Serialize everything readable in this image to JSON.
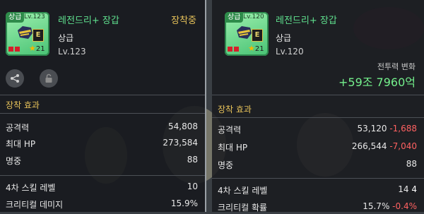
{
  "left": {
    "grade_tag": "상급",
    "level_tag": "Lv.123",
    "item_name": "레전드리+ 장갑",
    "equipped": "장착중",
    "grade": "상급",
    "level": "Lv.123",
    "star_count": "21",
    "e_badge": "E",
    "section_title": "장착 효과",
    "stats": [
      {
        "label": "공격력",
        "value": "54,808"
      },
      {
        "label": "최대 HP",
        "value": "273,584"
      },
      {
        "label": "명중",
        "value": "88"
      },
      {
        "label": "4차 스킬 레벨",
        "value": "10"
      },
      {
        "label": "크리티컬 데미지",
        "value": "15.9%"
      }
    ]
  },
  "right": {
    "grade_tag": "상급",
    "level_tag": "Lv.120",
    "item_name": "레전드리+ 장갑",
    "grade": "상급",
    "level": "Lv.120",
    "star_count": "21",
    "e_badge": "E",
    "power_label": "전투력 변화",
    "power_value": "+59조 7960억",
    "section_title": "장착 효과",
    "stats": [
      {
        "label": "공격력",
        "value": "53,120",
        "diff": "-1,688"
      },
      {
        "label": "최대 HP",
        "value": "266,544",
        "diff": "-7,040"
      },
      {
        "label": "명중",
        "value": "88",
        "diff": ""
      },
      {
        "label": "4차 스킬 레벨",
        "value": "14",
        "diff": "4"
      },
      {
        "label": "크리티컬 확률",
        "value": "15.7%",
        "diff": "-0.4%"
      }
    ]
  },
  "colors": {
    "item_name": "#5fe08e",
    "section_title": "#e8c35a",
    "negative": "#ff6161",
    "power_gain": "#74f08c"
  },
  "icons": [
    "share-icon",
    "unlock-icon",
    "glove-icon",
    "star-icon"
  ]
}
